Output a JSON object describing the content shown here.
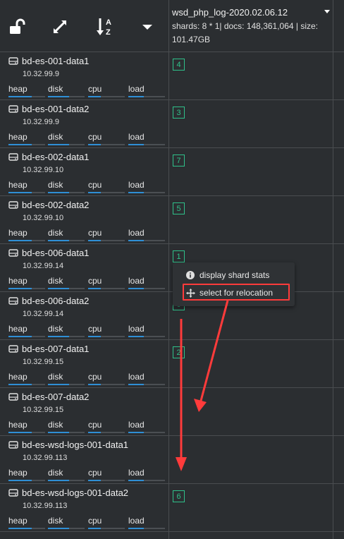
{
  "toolbar": {
    "icons": [
      "unlock-icon",
      "expand-icon",
      "sort-az-icon",
      "caret-down-icon"
    ]
  },
  "index": {
    "name": "wsd_php_log-2020.02.06.12",
    "meta_line1": "shards: 8 * 1| docs: 148,361,064 | size:",
    "meta_line2": "101.47GB"
  },
  "metric_labels": [
    "heap",
    "disk",
    "cpu",
    "load"
  ],
  "nodes": [
    {
      "name": "bd-es-001-data1",
      "ip": "10.32.99.9",
      "shard": "4"
    },
    {
      "name": "bd-es-001-data2",
      "ip": "10.32.99.9",
      "shard": "3"
    },
    {
      "name": "bd-es-002-data1",
      "ip": "10.32.99.10",
      "shard": "7"
    },
    {
      "name": "bd-es-002-data2",
      "ip": "10.32.99.10",
      "shard": "5"
    },
    {
      "name": "bd-es-006-data1",
      "ip": "10.32.99.14",
      "shard": "1"
    },
    {
      "name": "bd-es-006-data2",
      "ip": "10.32.99.14",
      "shard": "0"
    },
    {
      "name": "bd-es-007-data1",
      "ip": "10.32.99.15",
      "shard": "2"
    },
    {
      "name": "bd-es-007-data2",
      "ip": "10.32.99.15",
      "shard": ""
    },
    {
      "name": "bd-es-wsd-logs-001-data1",
      "ip": "10.32.99.113",
      "shard": ""
    },
    {
      "name": "bd-es-wsd-logs-001-data2",
      "ip": "10.32.99.113",
      "shard": "6"
    }
  ],
  "menu": {
    "display_label": "display shard stats",
    "relocate_label": "select for relocation"
  },
  "colors": {
    "shard_border": "#2fc18a",
    "bar_fill": "#2f8fd5",
    "annotation_red": "#ff3b3b"
  }
}
